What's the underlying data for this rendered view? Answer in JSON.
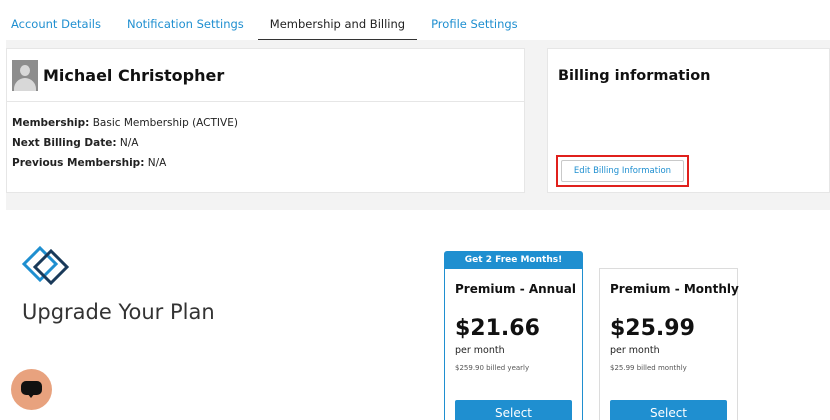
{
  "tabs": [
    {
      "label": "Account Details"
    },
    {
      "label": "Notification Settings"
    },
    {
      "label": "Membership and Billing"
    },
    {
      "label": "Profile Settings"
    }
  ],
  "active_tab": "Membership and Billing",
  "user": {
    "name": "Michael Christopher",
    "membership_label": "Membership:",
    "membership_value": "Basic Membership (ACTIVE)",
    "next_billing_label": "Next Billing Date:",
    "next_billing_value": "N/A",
    "previous_membership_label": "Previous Membership:",
    "previous_membership_value": "N/A"
  },
  "billing": {
    "title": "Billing information",
    "edit_button": "Edit Billing Information"
  },
  "upgrade": {
    "title": "Upgrade Your Plan"
  },
  "plans": [
    {
      "promo": "Get 2 Free Months!",
      "name": "Premium - Annual",
      "price": "$21.66",
      "per": "per month",
      "billed": "$259.90 billed yearly",
      "select": "Select"
    },
    {
      "name": "Premium - Monthly",
      "price": "$25.99",
      "per": "per month",
      "billed": "$25.99 billed monthly",
      "select": "Select"
    }
  ],
  "colors": {
    "accent": "#1f8fd0",
    "highlight": "#e0201c",
    "chat": "#e8a27e"
  }
}
